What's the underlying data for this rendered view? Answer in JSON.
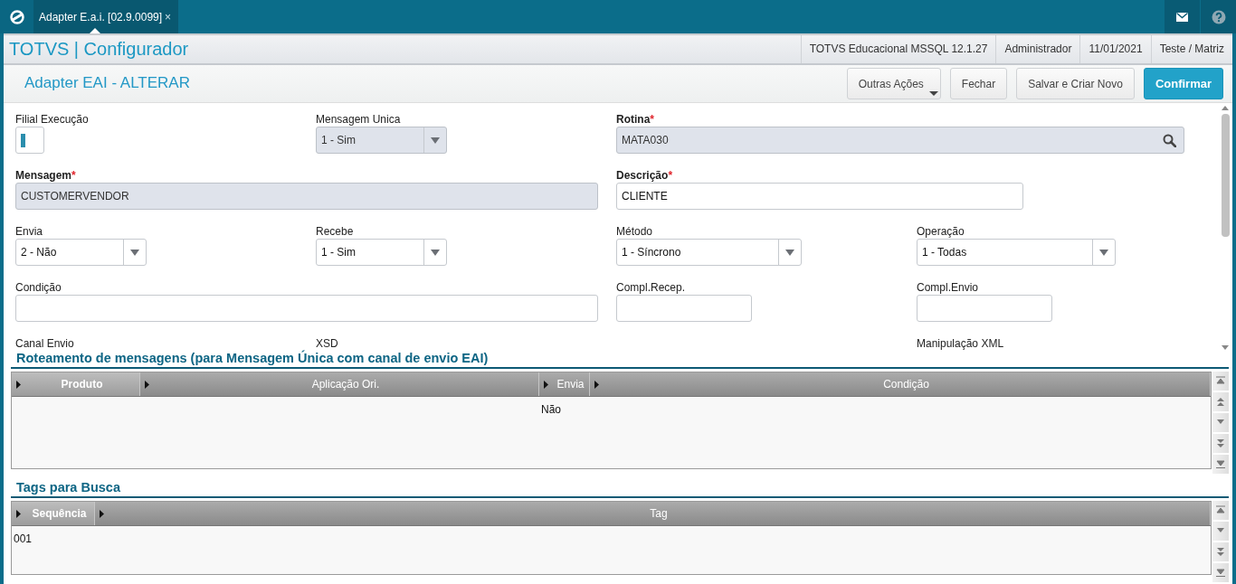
{
  "top_bar": {
    "tabs": [
      {
        "label": "Adapter E.a.i. [02.9.0099]",
        "close": "×",
        "selected": true
      }
    ]
  },
  "header": {
    "title": "TOTVS | Configurador",
    "info": [
      "TOTVS Educacional MSSQL 12.1.27",
      "Administrador",
      "11/01/2021",
      "Teste / Matriz"
    ]
  },
  "form": {
    "title": "Adapter EAI - ALTERAR",
    "buttons": [
      {
        "label": "Outras Ações",
        "kind": "menu"
      },
      {
        "label": "Fechar",
        "kind": "default"
      },
      {
        "label": "Salvar e Criar Novo",
        "kind": "default"
      },
      {
        "label": "Confirmar",
        "kind": "primary"
      }
    ],
    "fields": [
      {
        "label": "Filial Execução",
        "kind": "text",
        "required": false,
        "readonly": false,
        "focused": true
      },
      {
        "label": "Mensagem Unica",
        "kind": "select",
        "value": "1 - Sim",
        "required": false,
        "readonly": true,
        "focused": false
      },
      {
        "label": "Rotina",
        "required_mark": "*",
        "kind": "lookup",
        "value": "MATA030",
        "required": true,
        "readonly": true,
        "focused": false
      },
      {
        "label": "Mensagem",
        "required_mark": "*",
        "kind": "text",
        "value": "CUSTOMERVENDOR",
        "required": true,
        "readonly": true,
        "focused": false
      },
      {
        "label": "Descrição",
        "required_mark": "*",
        "kind": "text",
        "value": "CLIENTE",
        "required": true,
        "readonly": false,
        "focused": false
      },
      {
        "label": "Envia",
        "kind": "select",
        "value": "2 - Não",
        "required": false,
        "readonly": false,
        "focused": false
      },
      {
        "label": "Recebe",
        "kind": "select",
        "value": "1 - Sim",
        "required": false,
        "readonly": false,
        "focused": false
      },
      {
        "label": "Método",
        "kind": "select",
        "value": "1 - Síncrono",
        "required": false,
        "readonly": false,
        "focused": false
      },
      {
        "label": "Operação",
        "kind": "select",
        "value": "1 - Todas",
        "required": false,
        "readonly": false,
        "focused": false
      },
      {
        "label": "Condição",
        "kind": "text",
        "required": false,
        "readonly": false,
        "focused": false
      },
      {
        "label": "Compl.Recep.",
        "kind": "text",
        "required": false,
        "readonly": false,
        "focused": false
      },
      {
        "label": "Compl.Envio",
        "kind": "text",
        "required": false,
        "readonly": false,
        "focused": false
      }
    ],
    "more_labels": [
      "Canal Envio",
      "XSD",
      "Manipulação XML"
    ]
  },
  "grids": [
    {
      "title": "Roteamento de mensagens (para Mensagem Única com canal de envio EAI)",
      "columns": [
        {
          "label": "Produto",
          "selected": true
        },
        {
          "label": "Aplicação Ori.",
          "selected": false
        },
        {
          "label": "Envia",
          "selected": false
        },
        {
          "label": "Condição",
          "selected": false
        }
      ],
      "rows": [
        {
          "cells": [
            null,
            null,
            "Não",
            null
          ]
        }
      ]
    },
    {
      "title": "Tags para Busca",
      "columns": [
        {
          "label": "Sequência",
          "selected": true
        },
        {
          "label": "Tag",
          "selected": false
        }
      ],
      "rows": [
        {
          "cells": [
            "001",
            null
          ]
        }
      ]
    }
  ]
}
